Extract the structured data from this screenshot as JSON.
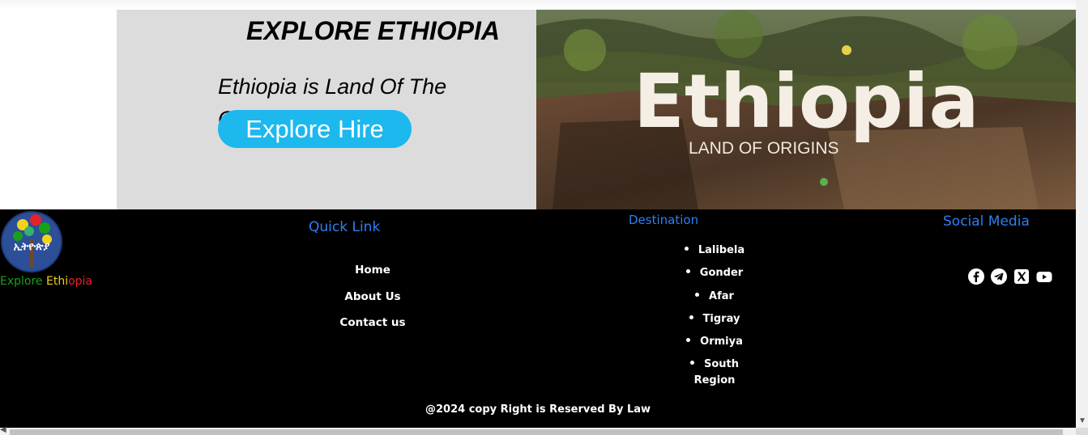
{
  "hero": {
    "title": "EXPLORE ETHIOPIA",
    "subtitle": "Ethiopia is Land Of The Origins",
    "button_label": "Explore Hire",
    "image": {
      "logo_word": "Ethiopia",
      "tagline": "LAND OF ORIGINS"
    }
  },
  "footer": {
    "logo_text": "ኢትዮጵያ",
    "brand": {
      "part1": "Explore ",
      "part2": "Ethi",
      "part3": "opia"
    },
    "quick_link": {
      "heading": "Quick Link",
      "items": [
        "Home",
        "About Us",
        "Contact us"
      ]
    },
    "destination": {
      "heading": "Destination",
      "items": [
        "Lalibela",
        "Gonder",
        "Afar",
        "Tigray",
        "Ormiya",
        "South Region"
      ]
    },
    "social": {
      "heading": "Social Media",
      "icons": [
        "facebook-icon",
        "telegram-icon",
        "x-icon",
        "youtube-icon"
      ]
    },
    "copyright": "@2024 copy Right is Reserved By Law"
  },
  "colors": {
    "accent_blue": "#1cb8ee",
    "heading_blue": "#2f7ff2",
    "footer_bg": "#000000",
    "hero_bg": "#dcdcdc"
  }
}
